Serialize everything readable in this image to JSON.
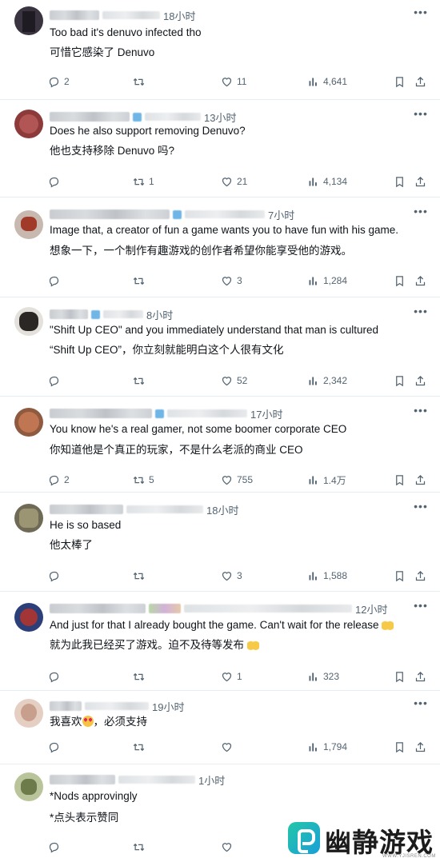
{
  "replies": [
    {
      "time": "18小时",
      "text_en": "Too bad it's denuvo infected tho",
      "text_zh": "可惜它感染了 Denuvo",
      "replies": "2",
      "retweets": "",
      "likes": "11",
      "views": "4,641"
    },
    {
      "time": "13小时",
      "text_en": "Does he also support removing Denuvo?",
      "text_zh": "他也支持移除 Denuvo 吗?",
      "replies": "",
      "retweets": "1",
      "likes": "21",
      "views": "4,134"
    },
    {
      "time": "7小时",
      "text_en": "Image that, a creator of fun a game wants you to have fun with his game.",
      "text_zh": "想象一下，一个制作有趣游戏的创作者希望你能享受他的游戏。",
      "replies": "",
      "retweets": "",
      "likes": "3",
      "views": "1,284"
    },
    {
      "time": "8小时",
      "text_en": "\"Shift Up CEO\" and you immediately understand that man is cultured",
      "text_zh": "“Shift Up CEO”，你立刻就能明白这个人很有文化",
      "replies": "",
      "retweets": "",
      "likes": "52",
      "views": "2,342"
    },
    {
      "time": "17小时",
      "text_en": "You know he's a real gamer, not some boomer corporate CEO",
      "text_zh": "你知道他是个真正的玩家，不是什么老派的商业 CEO",
      "replies": "2",
      "retweets": "5",
      "likes": "755",
      "views": "1.4万"
    },
    {
      "time": "18小时",
      "text_en": "He is so based",
      "text_zh": "他太棒了",
      "replies": "",
      "retweets": "",
      "likes": "3",
      "views": "1,588"
    },
    {
      "time": "12小时",
      "text_en": "And just for that I already bought the game. Can't wait for the release",
      "text_zh": "就为此我已经买了游戏。迫不及待等发布",
      "replies": "",
      "retweets": "",
      "likes": "1",
      "views": "323"
    },
    {
      "time": "19小时",
      "text_zh_a": "我喜欢",
      "text_zh_b": "，必须支持",
      "replies": "",
      "retweets": "",
      "likes": "",
      "views": "1,794"
    },
    {
      "time": "1小时",
      "text_en": "*Nods approvingly",
      "text_zh": "*点头表示赞同",
      "replies": "",
      "retweets": "",
      "likes": "",
      "views": ""
    }
  ],
  "watermark": {
    "name": "幽静游戏",
    "url": "WWW.YJISREN.COM"
  },
  "colors": {
    "text": "#0f1419",
    "muted": "#536471",
    "divider": "#e6ecf0",
    "verified": "#6fb6e6",
    "logo_gradient_start": "#23c6a8",
    "logo_gradient_end": "#1a9fd8"
  },
  "icons": [
    "reply-icon",
    "retweet-icon",
    "like-icon",
    "views-icon",
    "bookmark-icon",
    "share-icon",
    "more-icon"
  ]
}
